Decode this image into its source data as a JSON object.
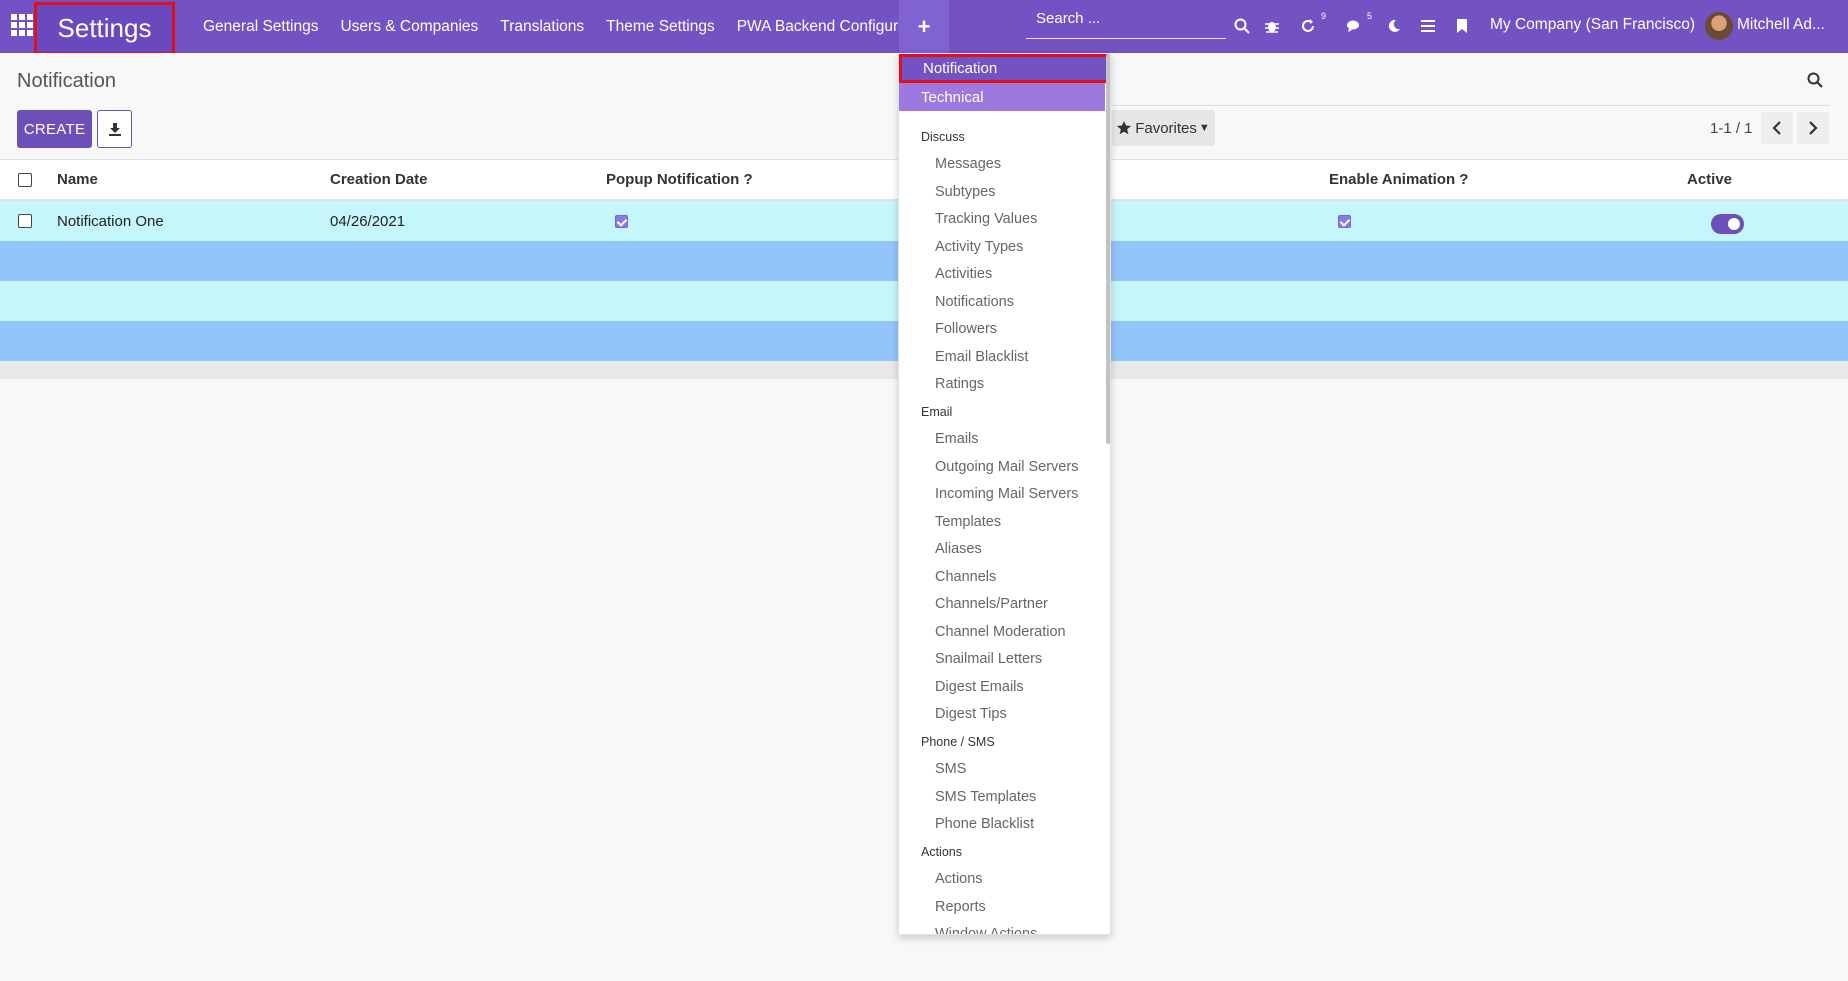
{
  "navbar": {
    "app_title": "Settings",
    "menu": [
      "General Settings",
      "Users & Companies",
      "Translations",
      "Theme Settings",
      "PWA Backend Configuration"
    ],
    "plus_label": "+",
    "search_placeholder": "Search ...",
    "activity_count": "9",
    "messages_count": "5",
    "company": "My Company (San Francisco)",
    "user": "Mitchell Ad..."
  },
  "control": {
    "breadcrumb": "Notification",
    "create_label": "CREATE",
    "favorites_label": "Favorites",
    "pager": "1-1 / 1"
  },
  "table": {
    "columns": [
      "Name",
      "Creation Date",
      "Popup Notification ?",
      "Enable Animation ?",
      "Active"
    ],
    "rows": [
      {
        "name": "Notification One",
        "date": "04/26/2021",
        "popup": true,
        "animation": true,
        "active": true
      }
    ]
  },
  "dropdown": {
    "selected": "Notification",
    "technical": "Technical",
    "sections": [
      {
        "header": "Discuss",
        "items": [
          "Messages",
          "Subtypes",
          "Tracking Values",
          "Activity Types",
          "Activities",
          "Notifications",
          "Followers",
          "Email Blacklist",
          "Ratings"
        ]
      },
      {
        "header": "Email",
        "items": [
          "Emails",
          "Outgoing Mail Servers",
          "Incoming Mail Servers",
          "Templates",
          "Aliases",
          "Channels",
          "Channels/Partner",
          "Channel Moderation",
          "Snailmail Letters",
          "Digest Emails",
          "Digest Tips"
        ]
      },
      {
        "header": "Phone / SMS",
        "items": [
          "SMS",
          "SMS Templates",
          "Phone Blacklist"
        ]
      },
      {
        "header": "Actions",
        "items": [
          "Actions",
          "Reports",
          "Window Actions"
        ]
      }
    ]
  },
  "colors": {
    "navbar": "#7352c4",
    "highlight_border": "#e0101a",
    "row_cyan": "#c5f6fb",
    "row_blue": "#93c5fb"
  }
}
